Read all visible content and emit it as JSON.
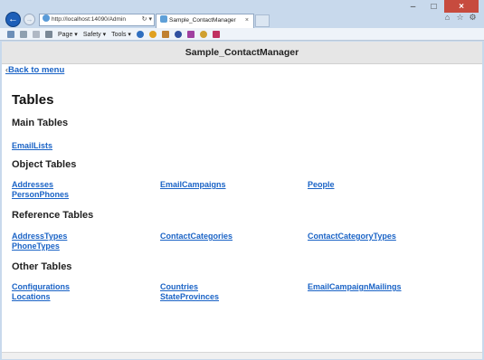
{
  "browser": {
    "address": "http://localhost:14090/Admin",
    "tab_title": "Sample_ContactManager",
    "tab_close": "×",
    "address_tools": "↻ ▾",
    "command_bar": {
      "page_label": "Page ▾",
      "safety_label": "Safety ▾",
      "tools_label": "Tools ▾"
    },
    "caption": {
      "minimize": "–",
      "maximize": "□",
      "close": "×"
    }
  },
  "page": {
    "header_title": "Sample_ContactManager",
    "back_link": "Back to menu",
    "back_chevron": "‹",
    "heading": "Tables",
    "sections": {
      "main": {
        "title": "Main Tables",
        "links": [
          "EmailLists"
        ]
      },
      "object": {
        "title": "Object Tables",
        "links": [
          "Addresses",
          "EmailCampaigns",
          "People",
          "PersonPhones"
        ]
      },
      "reference": {
        "title": "Reference Tables",
        "links": [
          "AddressTypes",
          "ContactCategories",
          "ContactCategoryTypes",
          "PhoneTypes"
        ]
      },
      "other": {
        "title": "Other Tables",
        "links": [
          "Configurations",
          "Countries",
          "EmailCampaignMailings",
          "Locations",
          "StateProvinces"
        ]
      }
    }
  },
  "colors": {
    "link": "#1a63c6",
    "header_bg": "#e6e6e6",
    "close_button": "#c74b3e",
    "back_button": "#1e5fb8"
  }
}
